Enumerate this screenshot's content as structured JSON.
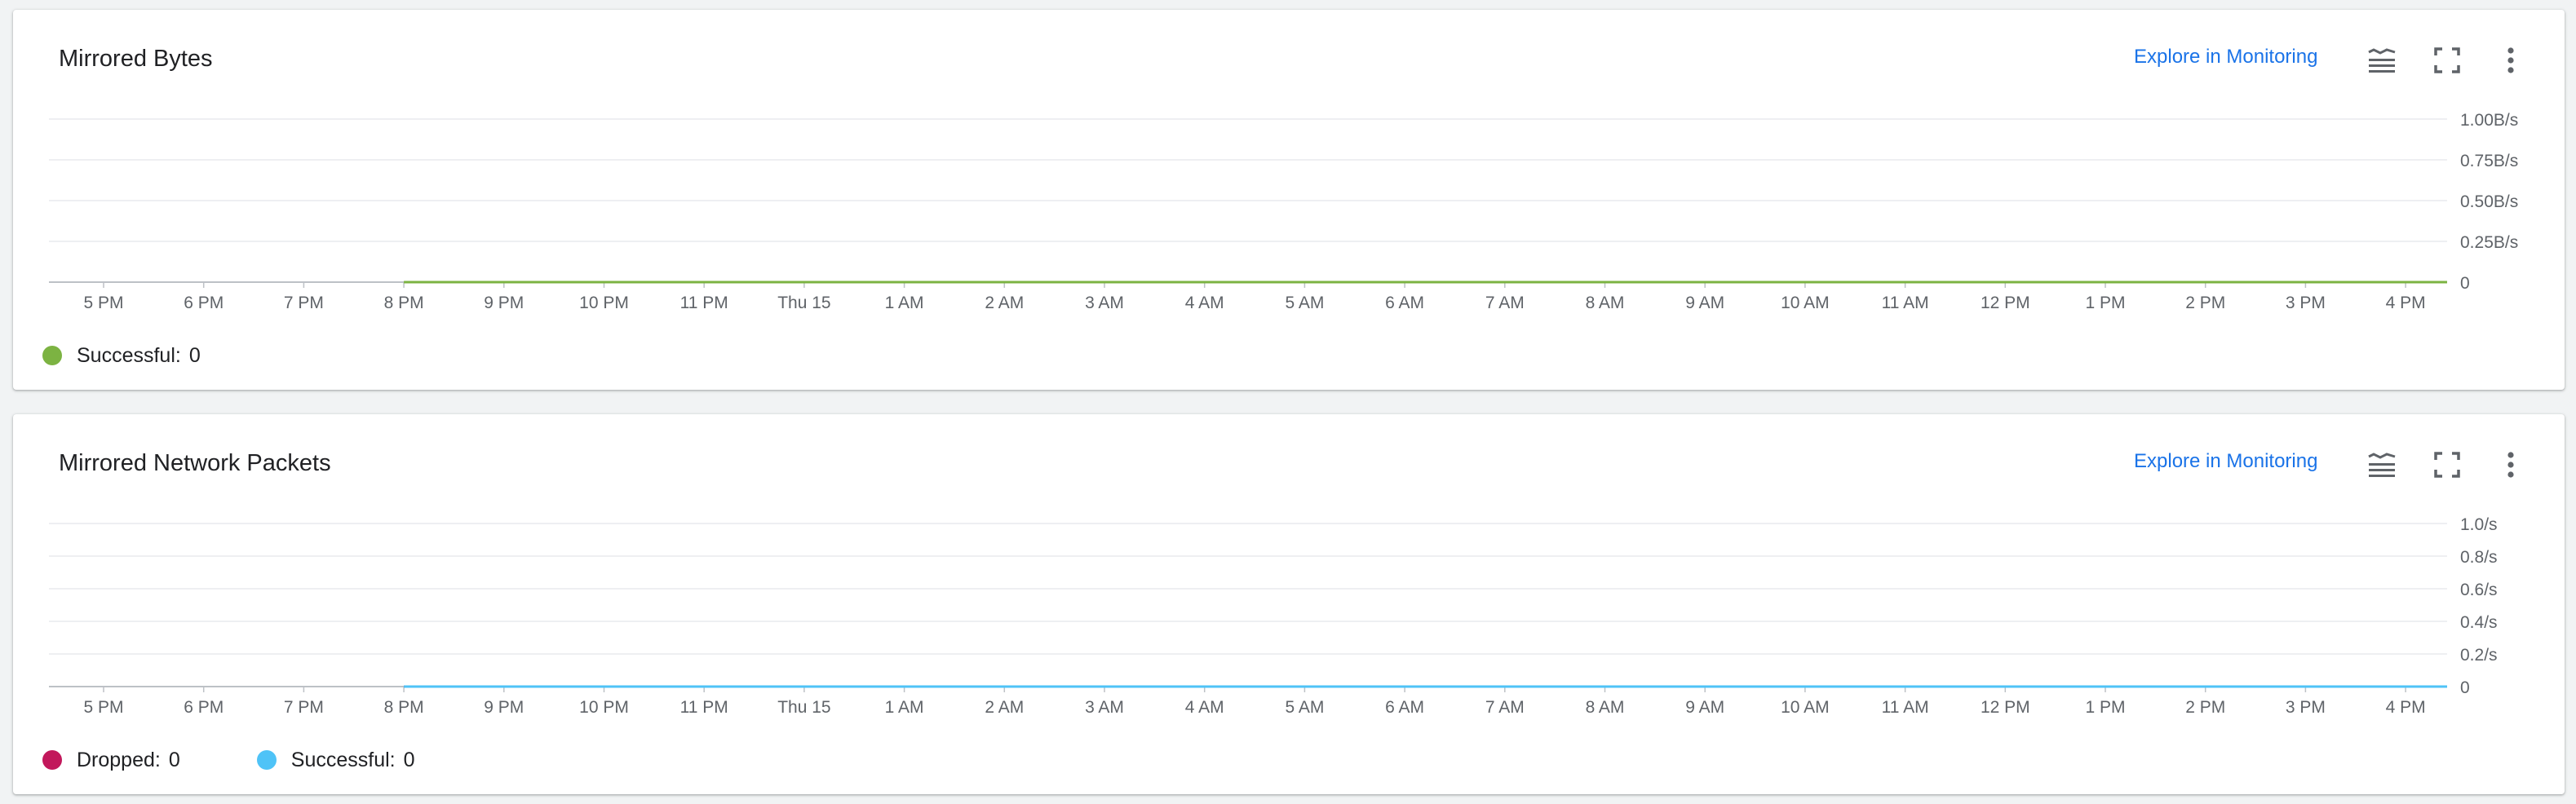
{
  "time_labels": [
    "5 PM",
    "6 PM",
    "7 PM",
    "8 PM",
    "9 PM",
    "10 PM",
    "11 PM",
    "Thu 15",
    "1 AM",
    "2 AM",
    "3 AM",
    "4 AM",
    "5 AM",
    "6 AM",
    "7 AM",
    "8 AM",
    "9 AM",
    "10 AM",
    "11 AM",
    "12 PM",
    "1 PM",
    "2 PM",
    "3 PM",
    "4 PM"
  ],
  "charts": [
    {
      "title": "Mirrored Bytes",
      "explore_label": "Explore in Monitoring",
      "icons": [
        "legend-toggle-icon",
        "fullscreen-icon",
        "more-vert-icon"
      ],
      "y_ticks": [
        "1.00B/s",
        "0.75B/s",
        "0.50B/s",
        "0.25B/s",
        "0"
      ],
      "legend": [
        {
          "name": "Successful:",
          "value": "0",
          "color": "#7cb342"
        }
      ]
    },
    {
      "title": "Mirrored Network Packets",
      "explore_label": "Explore in Monitoring",
      "icons": [
        "legend-toggle-icon",
        "fullscreen-icon",
        "more-vert-icon"
      ],
      "y_ticks": [
        "1.0/s",
        "0.8/s",
        "0.6/s",
        "0.4/s",
        "0.2/s",
        "0"
      ],
      "legend": [
        {
          "name": "Dropped:",
          "value": "0",
          "color": "#c2185b"
        },
        {
          "name": "Successful:",
          "value": "0",
          "color": "#4fc3f7"
        }
      ]
    }
  ],
  "chart_data": [
    {
      "type": "line",
      "title": "Mirrored Bytes",
      "x": [
        "5 PM",
        "6 PM",
        "7 PM",
        "8 PM",
        "9 PM",
        "10 PM",
        "11 PM",
        "Thu 15",
        "1 AM",
        "2 AM",
        "3 AM",
        "4 AM",
        "5 AM",
        "6 AM",
        "7 AM",
        "8 AM",
        "9 AM",
        "10 AM",
        "11 AM",
        "12 PM",
        "1 PM",
        "2 PM",
        "3 PM",
        "4 PM"
      ],
      "ylim": [
        0,
        1
      ],
      "y_unit": "B/s",
      "grid": true,
      "legend_position": "bottom-left",
      "series": [
        {
          "name": "Successful",
          "color": "#7cb342",
          "start_index": 3,
          "values": [
            0,
            0,
            0,
            0,
            0,
            0,
            0,
            0,
            0,
            0,
            0,
            0,
            0,
            0,
            0,
            0,
            0,
            0,
            0,
            0,
            0
          ]
        }
      ]
    },
    {
      "type": "line",
      "title": "Mirrored Network Packets",
      "x": [
        "5 PM",
        "6 PM",
        "7 PM",
        "8 PM",
        "9 PM",
        "10 PM",
        "11 PM",
        "Thu 15",
        "1 AM",
        "2 AM",
        "3 AM",
        "4 AM",
        "5 AM",
        "6 AM",
        "7 AM",
        "8 AM",
        "9 AM",
        "10 AM",
        "11 AM",
        "12 PM",
        "1 PM",
        "2 PM",
        "3 PM",
        "4 PM"
      ],
      "ylim": [
        0,
        1
      ],
      "y_unit": "/s",
      "grid": true,
      "legend_position": "bottom-left",
      "series": [
        {
          "name": "Dropped",
          "color": "#c2185b",
          "start_index": 3,
          "values": [
            0,
            0,
            0,
            0,
            0,
            0,
            0,
            0,
            0,
            0,
            0,
            0,
            0,
            0,
            0,
            0,
            0,
            0,
            0,
            0,
            0
          ]
        },
        {
          "name": "Successful",
          "color": "#4fc3f7",
          "start_index": 3,
          "values": [
            0,
            0,
            0,
            0,
            0,
            0,
            0,
            0,
            0,
            0,
            0,
            0,
            0,
            0,
            0,
            0,
            0,
            0,
            0,
            0,
            0
          ]
        }
      ]
    }
  ]
}
